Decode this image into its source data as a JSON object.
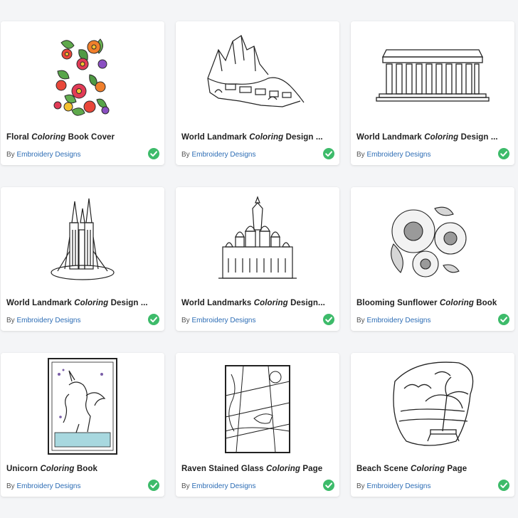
{
  "byline_prefix": "By",
  "check_color": "#3dbb6a",
  "author_color": "#2d6db5",
  "cards": [
    {
      "title_pre": "Floral ",
      "title_em": "Coloring",
      "title_post": " Book Cover",
      "author": "Embroidery Designs",
      "verified_icon": "check-circle-icon",
      "image": "floral-book-cover"
    },
    {
      "title_pre": "World Landmark ",
      "title_em": "Coloring",
      "title_post": " Design ...",
      "author": "Embroidery Designs",
      "verified_icon": "check-circle-icon",
      "image": "machu-picchu"
    },
    {
      "title_pre": "World Landmark ",
      "title_em": "Coloring",
      "title_post": " Design ...",
      "author": "Embroidery Designs",
      "verified_icon": "check-circle-icon",
      "image": "parthenon"
    },
    {
      "title_pre": "World Landmark ",
      "title_em": "Coloring",
      "title_post": " Design ...",
      "author": "Embroidery Designs",
      "verified_icon": "check-circle-icon",
      "image": "sagrada-familia"
    },
    {
      "title_pre": "World Landmarks ",
      "title_em": "Coloring",
      "title_post": " Design...",
      "author": "Embroidery Designs",
      "verified_icon": "check-circle-icon",
      "image": "st-basils-cathedral"
    },
    {
      "title_pre": "Blooming Sunflower ",
      "title_em": "Coloring",
      "title_post": " Book",
      "author": "Embroidery Designs",
      "verified_icon": "check-circle-icon",
      "image": "sunflowers"
    },
    {
      "title_pre": "Unicorn ",
      "title_em": "Coloring",
      "title_post": " Book",
      "author": "Embroidery Designs",
      "verified_icon": "check-circle-icon",
      "image": "unicorn"
    },
    {
      "title_pre": "Raven Stained Glass ",
      "title_em": "Coloring",
      "title_post": " Page",
      "author": "Embroidery Designs",
      "verified_icon": "check-circle-icon",
      "image": "raven-stained-glass"
    },
    {
      "title_pre": "Beach Scene ",
      "title_em": "Coloring",
      "title_post": " Page",
      "author": "Embroidery Designs",
      "verified_icon": "check-circle-icon",
      "image": "beach-scene"
    }
  ]
}
